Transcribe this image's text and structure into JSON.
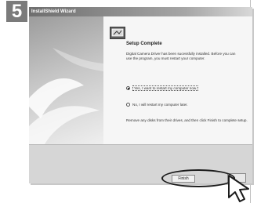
{
  "step": {
    "number": "5"
  },
  "window": {
    "title": "InstallShield Wizard"
  },
  "header": {
    "icon": "monitor-installer-icon"
  },
  "content": {
    "title": "Setup Complete",
    "description": "Digital Camera Driver has been sucessfully installed. Before you can use the program, you must restart your computer.",
    "options": [
      {
        "label": "Yes, I want to restart my computer now.",
        "selected": true
      },
      {
        "label": "No, I will restart my computer later.",
        "selected": false
      }
    ],
    "footer": "Remove any disks from their drives, and then click Finish to complete setup."
  },
  "buttons": {
    "finish_label": "Finish"
  },
  "colors": {
    "badge": "#7b7b7b",
    "highlight": "#1b1b1b",
    "panel": "#f6f6f6"
  }
}
